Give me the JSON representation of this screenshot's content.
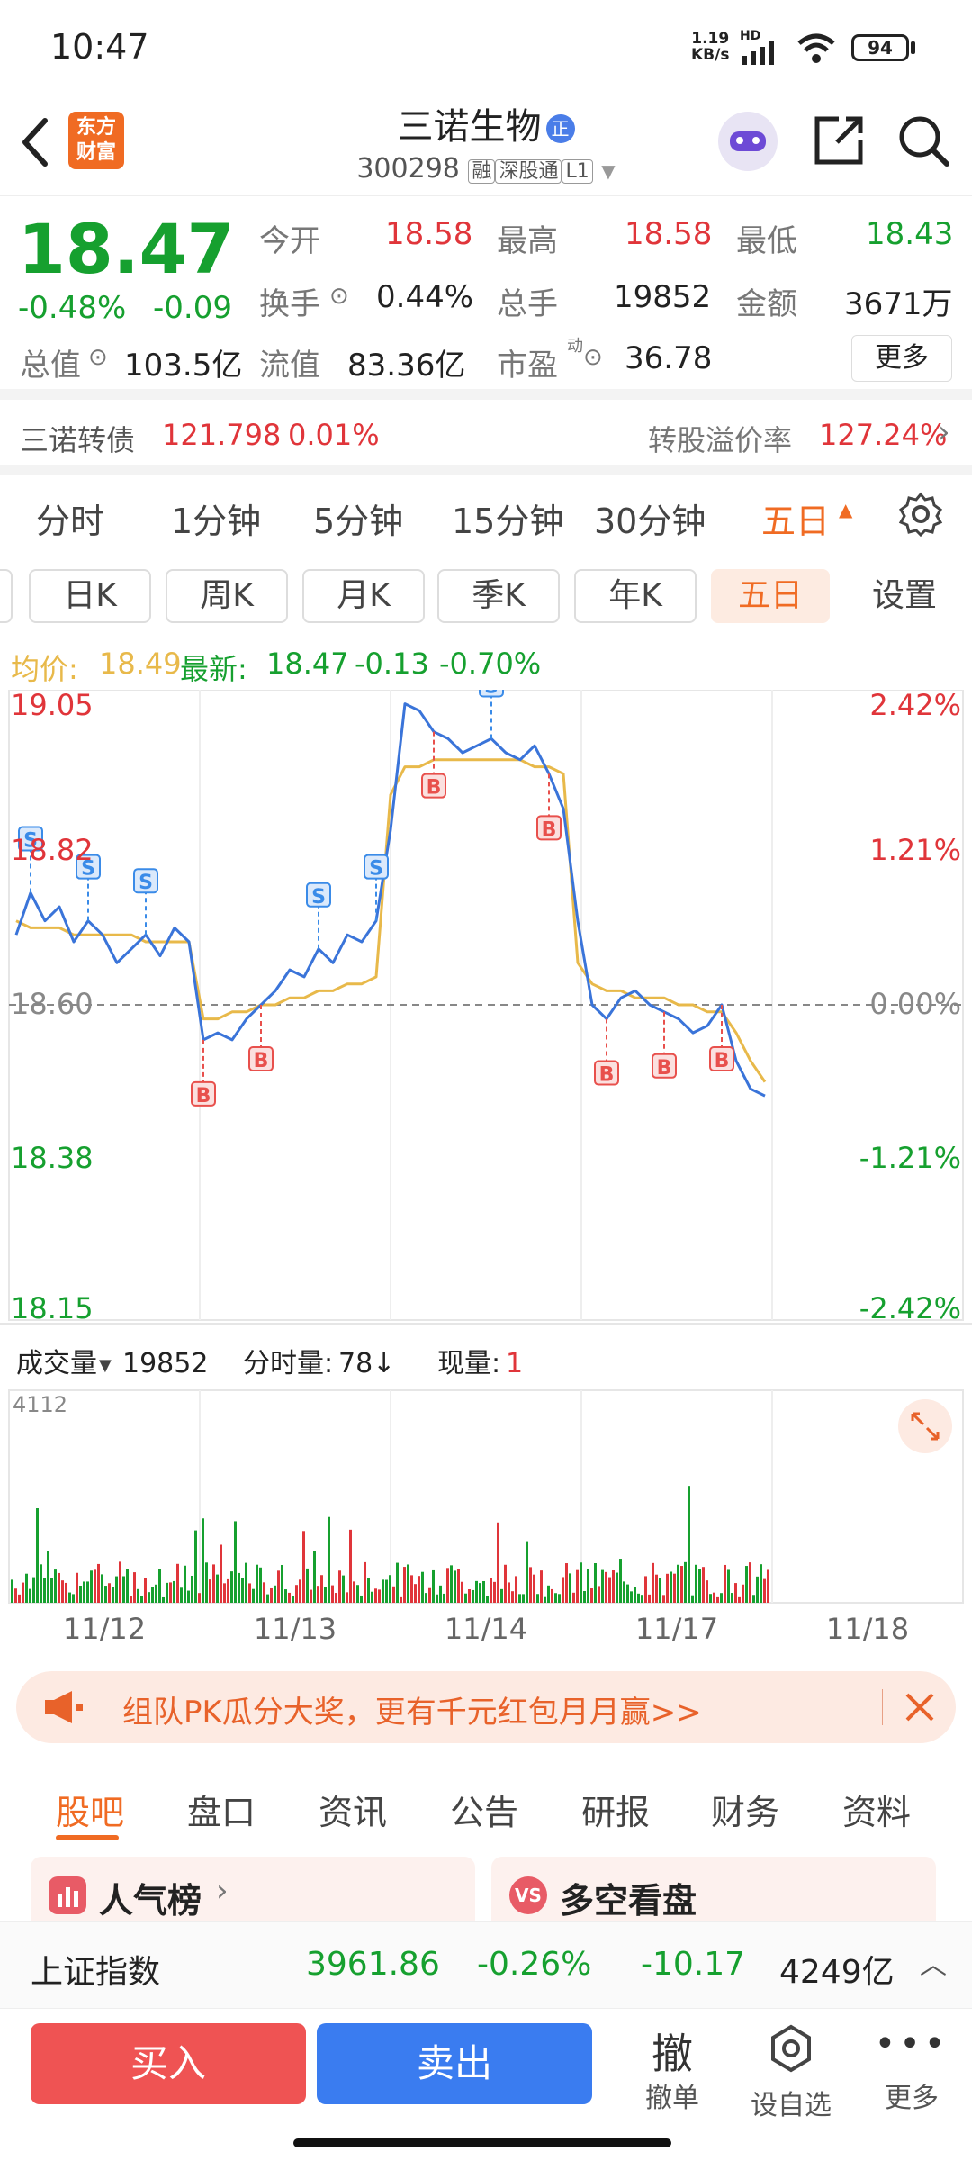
{
  "status": {
    "time": "10:47",
    "net_speed_top": "1.19",
    "net_speed_bottom": "KB/s",
    "hd": "HD",
    "battery": "94"
  },
  "header": {
    "logo": "东方\n财富",
    "title": "三诺生物",
    "badge": "正",
    "code": "300298",
    "tag1": "融",
    "tag2": "深股通",
    "tag3": "L1"
  },
  "quote": {
    "price": "18.47",
    "pct": "-0.48%",
    "chg": "-0.09",
    "open_label": "今开",
    "open": "18.58",
    "high_label": "最高",
    "high": "18.58",
    "low_label": "最低",
    "low": "18.43",
    "turnover_label": "换手",
    "turnover": "0.44%",
    "vol_label": "总手",
    "vol": "19852",
    "amount_label": "金额",
    "amount": "3671万",
    "mktcap_label": "总值",
    "mktcap": "103.5亿",
    "float_label": "流值",
    "float": "83.36亿",
    "pe_label": "市盈",
    "pe_sup": "动",
    "pe": "36.78",
    "more": "更多"
  },
  "convertible": {
    "name": "三诺转债",
    "price": "121.798",
    "pct": "0.01%",
    "premium_label": "转股溢价率",
    "premium": "127.24%"
  },
  "periods": [
    "分时",
    "1分钟",
    "5分钟",
    "15分钟",
    "30分钟",
    "五日"
  ],
  "ktabs": [
    "日K",
    "周K",
    "月K",
    "季K",
    "年K",
    "五日",
    "设置"
  ],
  "avgline": {
    "avg_label": "均价:",
    "avg": "18.49",
    "latest_label": "最新:",
    "latest": "18.47",
    "chg": "-0.13",
    "pct": "-0.70%"
  },
  "volume_bar": {
    "label": "成交量",
    "value": "19852",
    "tick_label": "分时量:",
    "tick_value": "78",
    "now_label": "现量:",
    "now_value": "1",
    "axis_max": "4112"
  },
  "chart_data": {
    "type": "line",
    "title": "",
    "days": [
      "11/12",
      "11/13",
      "11/14",
      "11/17",
      "11/18"
    ],
    "y_ticks_left": [
      "19.05",
      "18.82",
      "18.60",
      "18.38",
      "18.15"
    ],
    "y_ticks_right": [
      "2.42%",
      "1.21%",
      "0.00%",
      "-1.21%",
      "-2.42%"
    ],
    "ylim": [
      18.15,
      19.05
    ],
    "prev_close": 18.6,
    "price_series": [
      18.7,
      18.76,
      18.72,
      18.74,
      18.69,
      18.72,
      18.7,
      18.66,
      18.68,
      18.7,
      18.67,
      18.71,
      18.69,
      18.55,
      18.56,
      18.55,
      18.58,
      18.6,
      18.62,
      18.65,
      18.64,
      18.68,
      18.66,
      18.7,
      18.69,
      18.72,
      18.85,
      19.03,
      19.02,
      18.99,
      18.98,
      18.96,
      18.97,
      18.98,
      18.96,
      18.95,
      18.97,
      18.93,
      18.88,
      18.72,
      18.6,
      18.58,
      18.61,
      18.62,
      18.6,
      18.59,
      18.58,
      18.56,
      18.57,
      18.6,
      18.52,
      18.48,
      18.47
    ],
    "avg_series": [
      18.72,
      18.71,
      18.71,
      18.71,
      18.7,
      18.7,
      18.7,
      18.7,
      18.7,
      18.69,
      18.69,
      18.69,
      18.69,
      18.58,
      18.58,
      18.59,
      18.59,
      18.6,
      18.6,
      18.61,
      18.61,
      18.62,
      18.62,
      18.63,
      18.63,
      18.64,
      18.9,
      18.94,
      18.94,
      18.95,
      18.95,
      18.95,
      18.95,
      18.95,
      18.95,
      18.95,
      18.94,
      18.94,
      18.93,
      18.66,
      18.63,
      18.62,
      18.62,
      18.61,
      18.61,
      18.61,
      18.6,
      18.6,
      18.59,
      18.59,
      18.56,
      18.52,
      18.49
    ]
  },
  "banner": {
    "text": "组队PK瓜分大奖，更有千元红包月月赢>>"
  },
  "nav": [
    "股吧",
    "盘口",
    "资讯",
    "公告",
    "研报",
    "财务",
    "资料"
  ],
  "cards": [
    {
      "title": "人气榜"
    },
    {
      "title": "多空看盘"
    }
  ],
  "index": {
    "name": "上证指数",
    "value": "3961.86",
    "pct": "-0.26%",
    "chg": "-10.17",
    "amount": "4249亿"
  },
  "bottom": {
    "buy": "买入",
    "sell": "卖出",
    "cancel_icon": "撤",
    "cancel": "撤单",
    "watch": "设自选",
    "more": "更多"
  },
  "colors": {
    "up": "#e0353a",
    "down": "#16a02f",
    "price_line": "#3a74d9",
    "avg_line": "#e8b94a",
    "accent": "#f06b23",
    "buy_btn": "#ef5353",
    "sell_btn": "#3a7cf0"
  }
}
